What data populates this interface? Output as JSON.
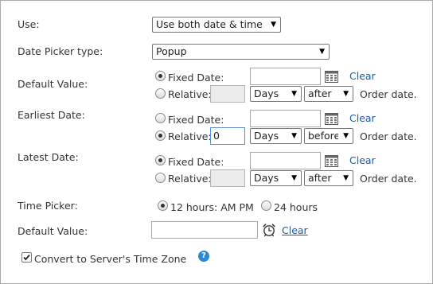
{
  "use": {
    "label": "Use:",
    "value": "Use both date & time"
  },
  "picker_type": {
    "label": "Date Picker type:",
    "value": "Popup"
  },
  "default_date": {
    "label": "Default Value:",
    "fixed_label": "Fixed Date:",
    "fixed_value": "",
    "fixed_checked": true,
    "relative_label": "Relative:",
    "relative_value": "",
    "relative_checked": false,
    "unit": "Days",
    "direction": "after",
    "suffix": "Order date.",
    "clear": "Clear"
  },
  "earliest_date": {
    "label": "Earliest Date:",
    "fixed_label": "Fixed Date:",
    "fixed_value": "",
    "fixed_checked": false,
    "relative_label": "Relative:",
    "relative_value": "0",
    "relative_checked": true,
    "unit": "Days",
    "direction": "before",
    "suffix": "Order date.",
    "clear": "Clear"
  },
  "latest_date": {
    "label": "Latest Date:",
    "fixed_label": "Fixed Date:",
    "fixed_value": "",
    "fixed_checked": true,
    "relative_label": "Relative:",
    "relative_value": "",
    "relative_checked": false,
    "unit": "Days",
    "direction": "after",
    "suffix": "Order date.",
    "clear": "Clear"
  },
  "time_picker": {
    "label": "Time Picker:",
    "opt12": "12 hours: AM PM",
    "opt12_checked": true,
    "opt24": "24 hours",
    "opt24_checked": false
  },
  "default_time": {
    "label": "Default Value:",
    "value": "",
    "clear": "Clear"
  },
  "convert_tz": {
    "label": "Convert to Server's Time Zone",
    "checked": true
  },
  "icons": {
    "calendar": "calendar-icon",
    "clock": "alarm-clock-icon",
    "help": "help-icon",
    "dropdown": "chevron-down-icon"
  },
  "colors": {
    "link": "#1a5aa6",
    "help_badge": "#2e86d6",
    "border": "#a9a9a9",
    "disabled_field": "#ececec"
  }
}
